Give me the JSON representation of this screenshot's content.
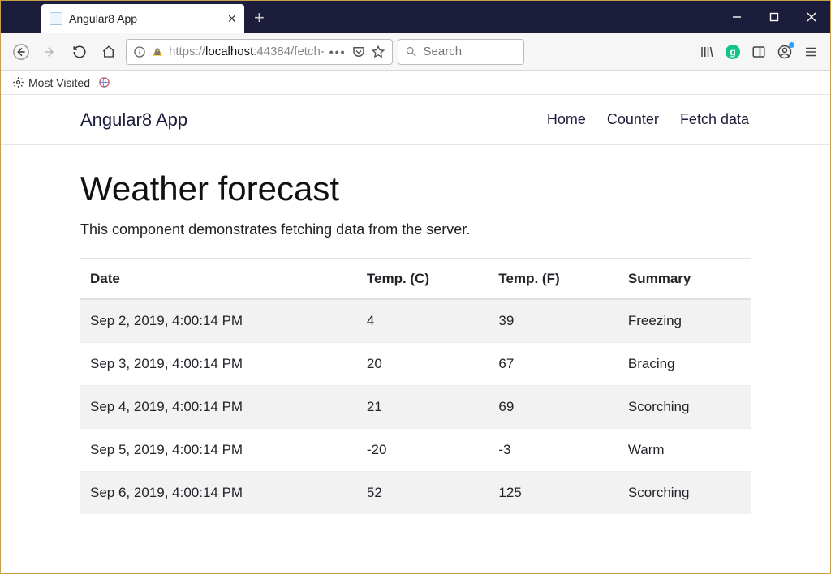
{
  "browser": {
    "tab_title": "Angular8 App",
    "url_prefix": "https://",
    "url_host": "localhost",
    "url_port_path": ":44384/fetch-",
    "search_placeholder": "Search",
    "bookmarks": {
      "most_visited": "Most Visited"
    }
  },
  "app": {
    "brand": "Angular8 App",
    "nav": {
      "home": "Home",
      "counter": "Counter",
      "fetch": "Fetch data"
    },
    "heading": "Weather forecast",
    "lead": "This component demonstrates fetching data from the server.",
    "columns": {
      "date": "Date",
      "tc": "Temp. (C)",
      "tf": "Temp. (F)",
      "summary": "Summary"
    },
    "rows": [
      {
        "date": "Sep 2, 2019, 4:00:14 PM",
        "tc": "4",
        "tf": "39",
        "summary": "Freezing"
      },
      {
        "date": "Sep 3, 2019, 4:00:14 PM",
        "tc": "20",
        "tf": "67",
        "summary": "Bracing"
      },
      {
        "date": "Sep 4, 2019, 4:00:14 PM",
        "tc": "21",
        "tf": "69",
        "summary": "Scorching"
      },
      {
        "date": "Sep 5, 2019, 4:00:14 PM",
        "tc": "-20",
        "tf": "-3",
        "summary": "Warm"
      },
      {
        "date": "Sep 6, 2019, 4:00:14 PM",
        "tc": "52",
        "tf": "125",
        "summary": "Scorching"
      }
    ]
  }
}
